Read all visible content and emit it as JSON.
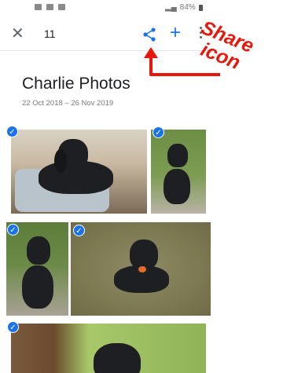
{
  "status_bar": {
    "battery": "84%"
  },
  "toolbar": {
    "count": "11",
    "close_icon": "close-icon",
    "share_icon": "share-icon",
    "add_icon": "plus-icon",
    "more_icon": "more-vert-icon"
  },
  "annotation": {
    "line1": "Share",
    "line2": "icon",
    "color": "#e8160b"
  },
  "album": {
    "title": "Charlie Photos",
    "date_range": "22 Oct 2018 – 26 Nov 2019"
  },
  "colors": {
    "accent": "#1a73e8"
  },
  "photos": [
    {
      "id": "photo-1",
      "selected": true
    },
    {
      "id": "photo-2",
      "selected": true
    },
    {
      "id": "photo-3",
      "selected": true
    },
    {
      "id": "photo-4",
      "selected": true
    },
    {
      "id": "photo-5",
      "selected": true
    }
  ]
}
